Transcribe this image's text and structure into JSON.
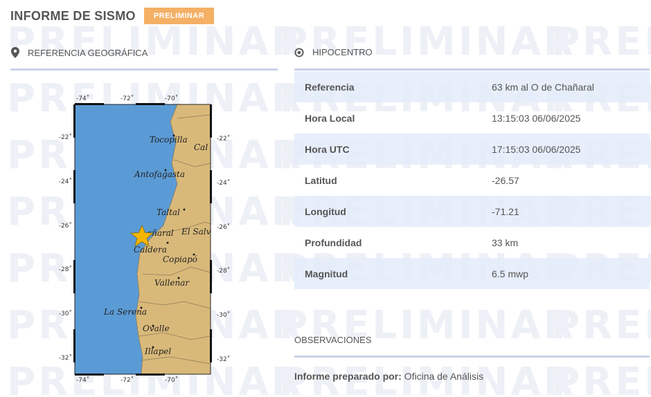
{
  "header": {
    "title": "INFORME DE SISMO",
    "badge": "PRELIMINAR"
  },
  "watermark": {
    "text": "PRELIMINAR"
  },
  "geo": {
    "heading": "REFERENCIA GEOGRÁFICA",
    "icon": "map-pin-icon"
  },
  "map": {
    "lon_ticks": [
      "-74˚",
      "-72˚",
      "-70˚"
    ],
    "lat_ticks": [
      "-22˚",
      "-24˚",
      "-26˚",
      "-28˚",
      "-30˚",
      "-32˚"
    ],
    "places": [
      "Tocopilla",
      "Cal",
      "Antofagasta",
      "Taltal",
      "El Salv",
      "añaral",
      "Caldera",
      "Copiapó",
      "Vallenar",
      "La Serena",
      "Ovalle",
      "Illapel"
    ],
    "colors": {
      "ocean": "#5b9bd5",
      "land": "#d9b97a",
      "epicenter": "#f5b500"
    }
  },
  "hypocenter": {
    "heading": "HIPOCENTRO",
    "icon": "target-icon",
    "rows": [
      {
        "label": "Referencia",
        "value": "63 km al O de Chañaral"
      },
      {
        "label": "Hora Local",
        "value": "13:15:03 06/06/2025"
      },
      {
        "label": "Hora UTC",
        "value": "17:15:03 06/06/2025"
      },
      {
        "label": "Latitud",
        "value": "-26.57"
      },
      {
        "label": "Longitud",
        "value": "-71.21"
      },
      {
        "label": "Profundidad",
        "value": "33 km"
      },
      {
        "label": "Magnitud",
        "value": "6.5 mwp"
      }
    ]
  },
  "observations": {
    "heading": "OBSERVACIONES",
    "prepared_label": "Informe preparado por:",
    "prepared_value": "Oficina de Análisis"
  }
}
